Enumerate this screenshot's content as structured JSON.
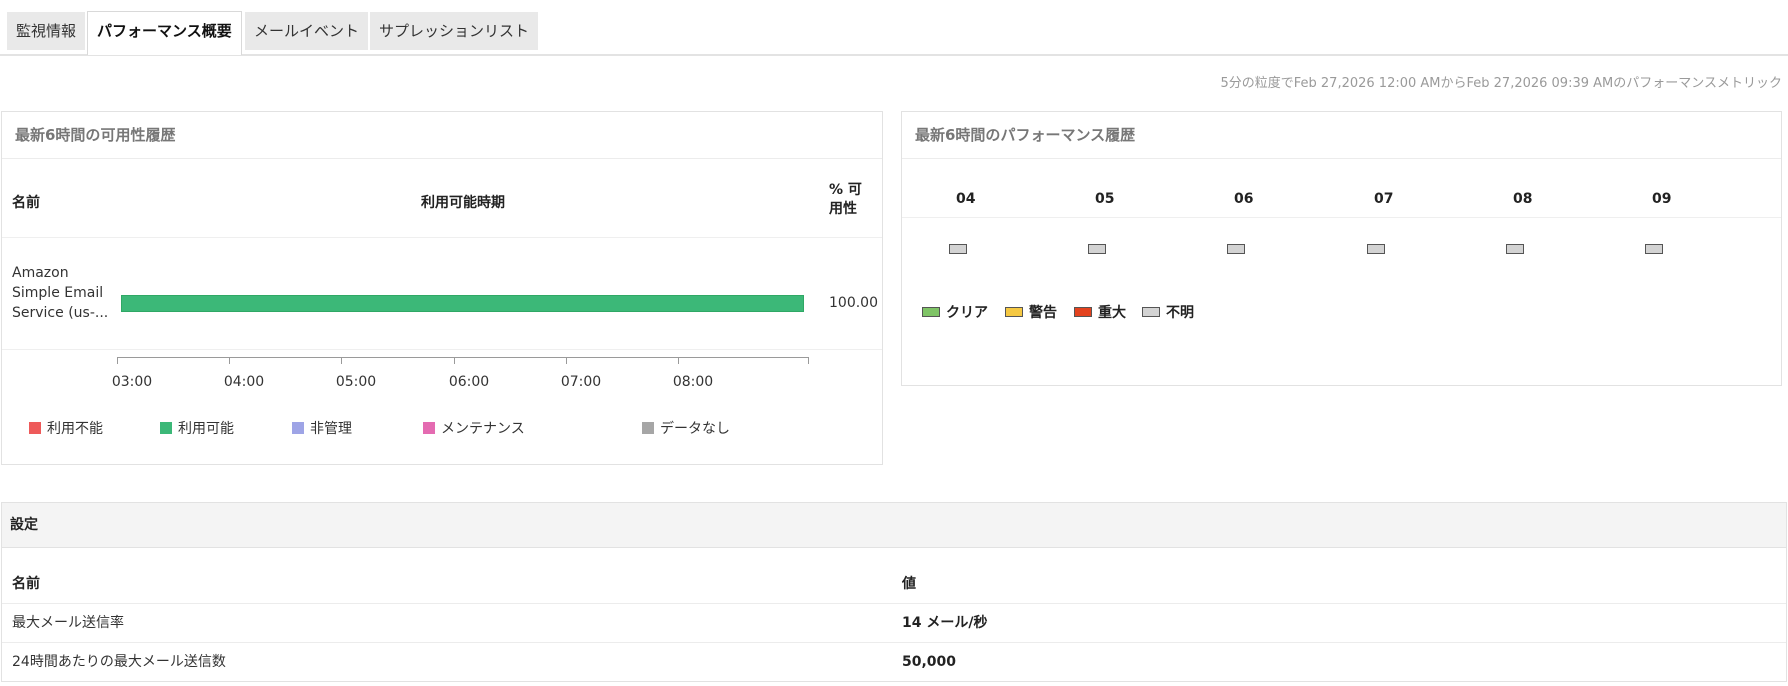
{
  "tabs": [
    {
      "label": "監視情報",
      "active": false
    },
    {
      "label": "パフォーマンス概要",
      "active": true
    },
    {
      "label": "メールイベント",
      "active": false
    },
    {
      "label": "サプレッションリスト",
      "active": false
    }
  ],
  "timestamp": "5分の粒度でFeb 27,2026 12:00 AMからFeb 27,2026 09:39 AMのパフォーマンスメトリック",
  "availability": {
    "title": "最新6時間の可用性履歴",
    "col_name": "名前",
    "col_period": "利用可能時期",
    "col_pct": "% 可用性",
    "service_name": "Amazon Simple Email Service (us-...",
    "status_color": "#3cb878",
    "percent": "100.00",
    "ticks": [
      "03:00",
      "04:00",
      "05:00",
      "06:00",
      "07:00",
      "08:00"
    ],
    "legend": [
      {
        "label": "利用不能",
        "color": "#ee5a5a"
      },
      {
        "label": "利用可能",
        "color": "#3cb878"
      },
      {
        "label": "非管理",
        "color": "#9ea4e6"
      },
      {
        "label": "メンテナンス",
        "color": "#e46bb1"
      },
      {
        "label": "データなし",
        "color": "#a6a6a6"
      }
    ]
  },
  "performance": {
    "title": "最新6時間のパフォーマンス履歴",
    "hours": [
      "04",
      "05",
      "06",
      "07",
      "08",
      "09"
    ],
    "cell_status": "不明",
    "legend": [
      {
        "label": "クリア",
        "color": "#7fc466"
      },
      {
        "label": "警告",
        "color": "#f5c842"
      },
      {
        "label": "重大",
        "color": "#e3421e"
      },
      {
        "label": "不明",
        "color": "#d3d3d3"
      }
    ]
  },
  "settings": {
    "title": "設定",
    "col_name": "名前",
    "col_value": "値",
    "rows": [
      {
        "name": "最大メール送信率",
        "value": "14 メール/秒"
      },
      {
        "name": "24時間あたりの最大メール送信数",
        "value": "50,000"
      }
    ]
  }
}
